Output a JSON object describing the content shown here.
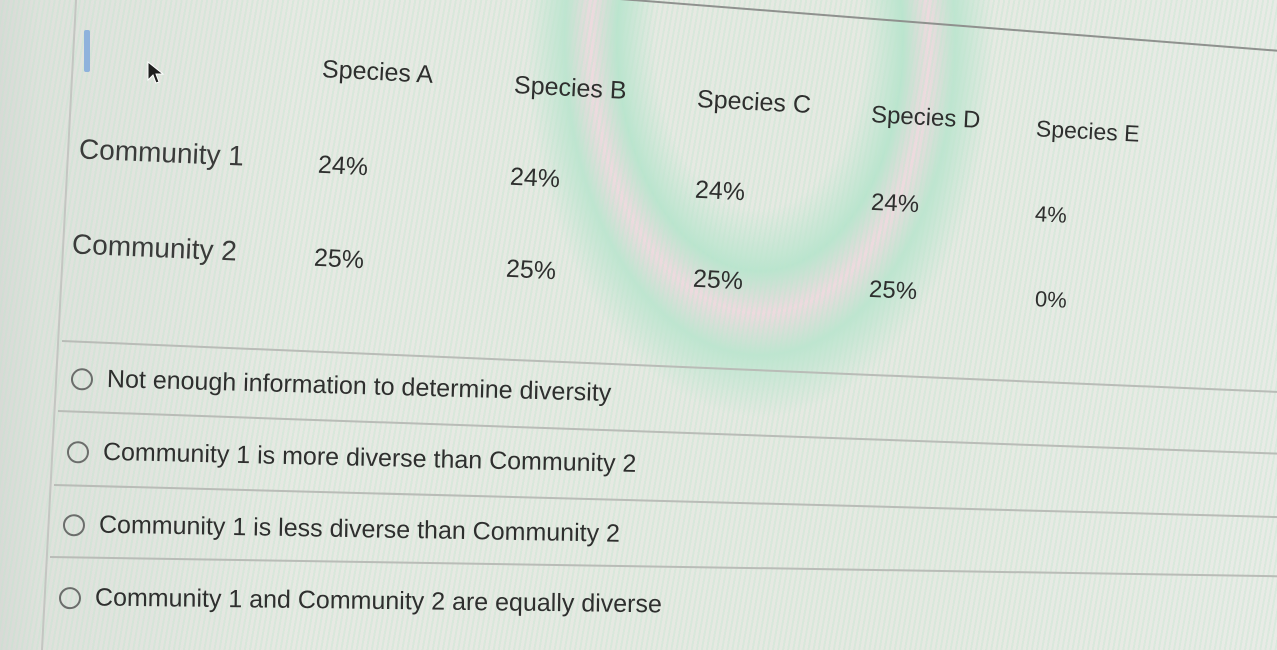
{
  "table": {
    "columns": [
      "Species A",
      "Species B",
      "Species C",
      "Species D",
      "Species E"
    ],
    "rows": [
      {
        "label": "Community 1",
        "values": [
          "24%",
          "24%",
          "24%",
          "24%",
          "4%"
        ]
      },
      {
        "label": "Community 2",
        "values": [
          "25%",
          "25%",
          "25%",
          "25%",
          "0%"
        ]
      }
    ]
  },
  "question": {
    "options": [
      {
        "label": "Not enough information to determine diversity",
        "selected": false
      },
      {
        "label": "Community 1 is more diverse than Community 2",
        "selected": false
      },
      {
        "label": "Community 1 is less diverse than Community 2",
        "selected": false
      },
      {
        "label": "Community 1 and Community 2 are equally diverse",
        "selected": false
      }
    ]
  },
  "colors": {
    "text": "#2e2f2e",
    "focus_indicator": "#8fb2dc",
    "radio_border": "#6b6d6b"
  }
}
